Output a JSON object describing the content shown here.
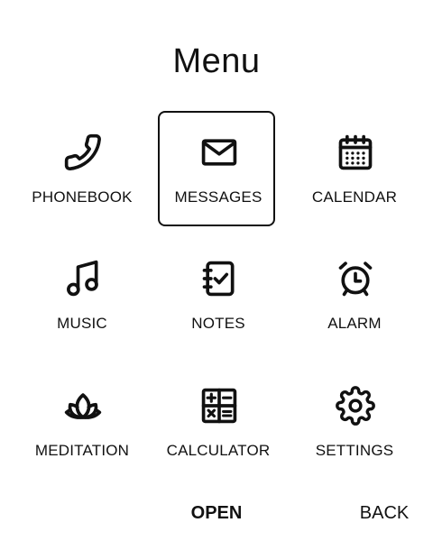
{
  "header": {
    "title": "Menu"
  },
  "menu": {
    "selected_index": 1,
    "items": [
      {
        "label": "PHONEBOOK",
        "icon": "phone-icon"
      },
      {
        "label": "MESSAGES",
        "icon": "envelope-icon"
      },
      {
        "label": "CALENDAR",
        "icon": "calendar-icon"
      },
      {
        "label": "MUSIC",
        "icon": "music-note-icon"
      },
      {
        "label": "NOTES",
        "icon": "notepad-check-icon"
      },
      {
        "label": "ALARM",
        "icon": "alarm-clock-icon"
      },
      {
        "label": "MEDITATION",
        "icon": "lotus-icon"
      },
      {
        "label": "CALCULATOR",
        "icon": "calculator-icon"
      },
      {
        "label": "SETTINGS",
        "icon": "gear-icon"
      }
    ]
  },
  "softkeys": {
    "left": "OPEN",
    "right": "BACK"
  }
}
